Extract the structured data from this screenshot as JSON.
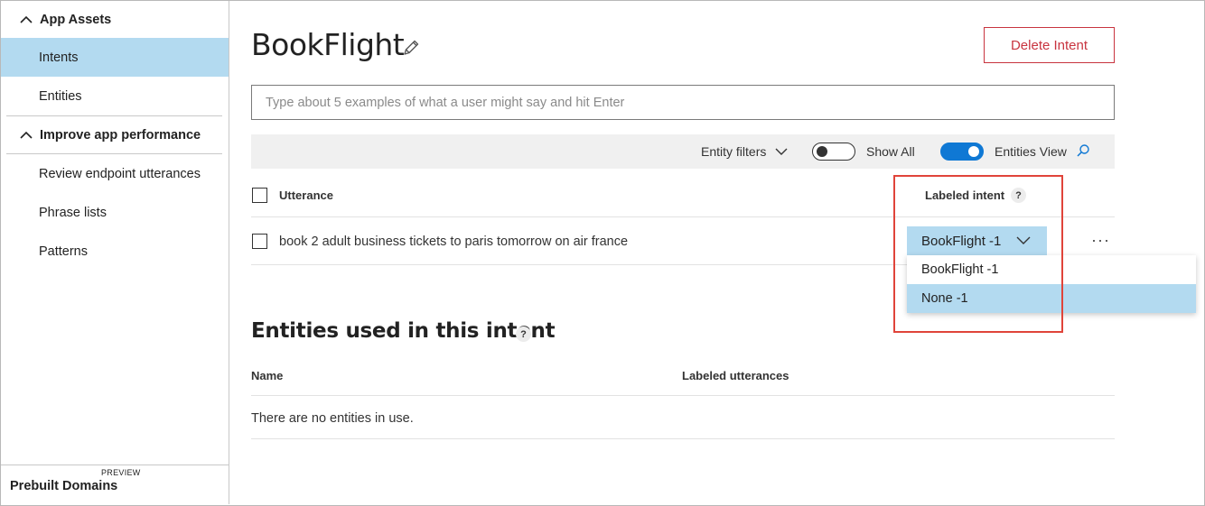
{
  "sidebar": {
    "app_assets": "App Assets",
    "intents": "Intents",
    "entities": "Entities",
    "improve": "Improve app performance",
    "review": "Review endpoint utterances",
    "phrase_lists": "Phrase lists",
    "patterns": "Patterns",
    "prebuilt": "Prebuilt Domains",
    "preview_badge": "PREVIEW"
  },
  "main": {
    "title": "BookFlight",
    "delete_label": "Delete Intent",
    "input_placeholder": "Type about 5 examples of what a user might say and hit Enter",
    "toolbar": {
      "entity_filters": "Entity filters",
      "show_all": "Show All",
      "show_all_on": false,
      "entities_view": "Entities View",
      "entities_view_on": true
    },
    "table": {
      "col_utterance": "Utterance",
      "col_labeled_intent": "Labeled intent",
      "help": "?",
      "rows": [
        {
          "utterance": "book 2 adult business tickets to paris tomorrow on air france",
          "intent": "BookFlight -1"
        }
      ]
    },
    "dropdown": {
      "options": [
        "BookFlight -1",
        "None -1"
      ],
      "highlighted_index": 1
    },
    "entities_section": {
      "title": "Entities used in this intent",
      "help": "?",
      "col_name": "Name",
      "col_labeled": "Labeled utterances",
      "empty_message": "There are no entities in use."
    }
  },
  "colors": {
    "accent": "#0f78d4",
    "selection": "#b3daf0",
    "danger": "#c8343f",
    "annotation": "#e0443a"
  }
}
